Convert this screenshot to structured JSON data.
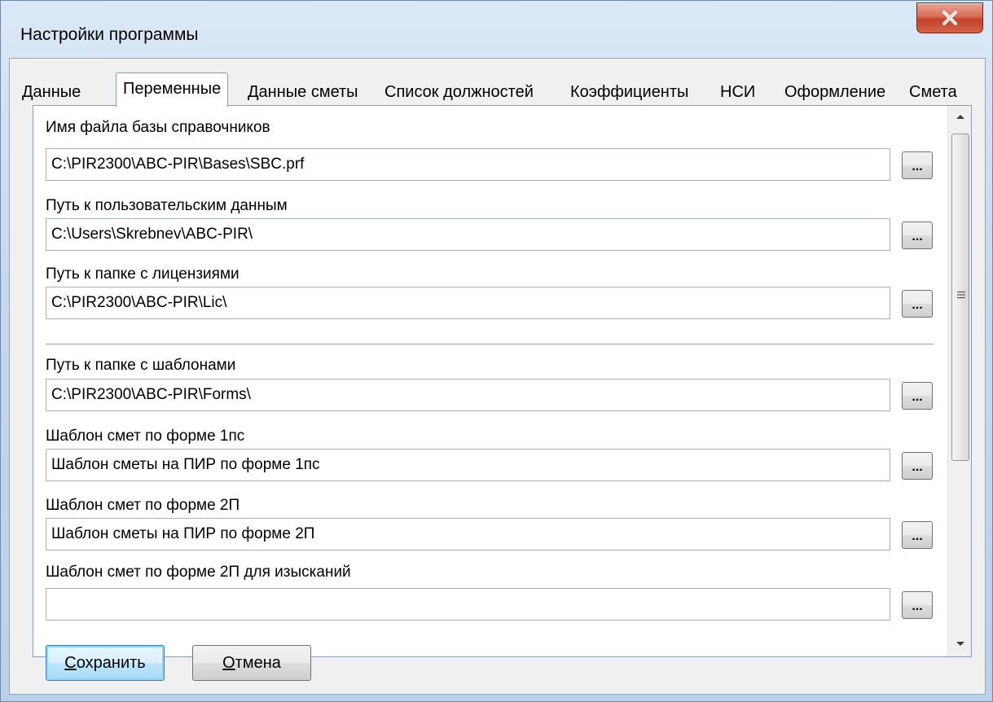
{
  "window": {
    "title": "Настройки программы"
  },
  "tabs": [
    {
      "label": "Данные"
    },
    {
      "label": "Переменные"
    },
    {
      "label": "Данные сметы"
    },
    {
      "label": "Список должностей"
    },
    {
      "label": "Коэффициенты"
    },
    {
      "label": "НСИ"
    },
    {
      "label": "Оформление"
    },
    {
      "label": "Смета"
    }
  ],
  "active_tab": "Переменные",
  "fields": [
    {
      "label": "Имя файла базы справочников",
      "value": "C:\\PIR2300\\ABC-PIR\\Bases\\SBC.prf",
      "browse_label": "..."
    },
    {
      "label": "Путь к пользовательским данным",
      "value": "C:\\Users\\Skrebnev\\ABC-PIR\\",
      "browse_label": "..."
    },
    {
      "label": "Путь к папке с лицензиями",
      "value": "C:\\PIR2300\\ABC-PIR\\Lic\\",
      "browse_label": "..."
    },
    {
      "label": "Путь к папке с шаблонами",
      "value": "C:\\PIR2300\\ABC-PIR\\Forms\\",
      "browse_label": "..."
    },
    {
      "label": "Шаблон смет по форме 1пс",
      "value": "Шаблон сметы на ПИР по форме 1пс",
      "browse_label": "..."
    },
    {
      "label": "Шаблон смет по форме 2П",
      "value": "Шаблон сметы на ПИР по форме 2П",
      "browse_label": "..."
    },
    {
      "label": "Шаблон смет по форме 2П для изысканий",
      "value": "",
      "browse_label": "..."
    }
  ],
  "buttons": {
    "save": {
      "mnemonic": "С",
      "rest": "охранить"
    },
    "cancel": {
      "mnemonic": "О",
      "rest": "тмена"
    }
  },
  "colors": {
    "close_button": "#c74a2c",
    "frame": "#bcd0ea",
    "default_button_glow": "#8fd3fb"
  }
}
